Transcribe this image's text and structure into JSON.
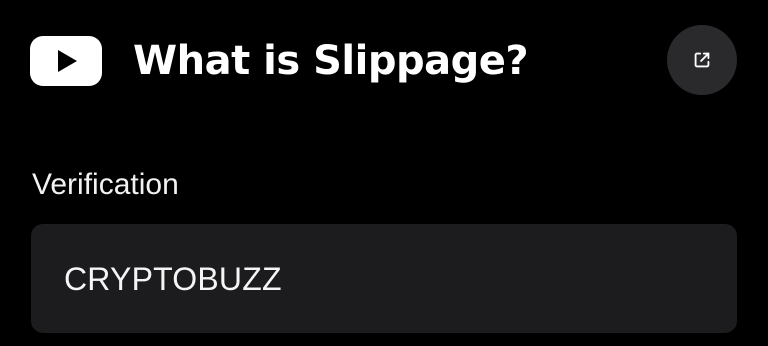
{
  "header": {
    "logo_icon": "youtube-play-icon",
    "title": "What is Slippage?",
    "share_icon": "external-link-icon"
  },
  "verification": {
    "label": "Verification",
    "value": "CRYPTOBUZZ"
  },
  "colors": {
    "background": "#000000",
    "text": "#ffffff",
    "button_bg": "#2a2a2c",
    "field_bg": "#1c1c1e"
  }
}
